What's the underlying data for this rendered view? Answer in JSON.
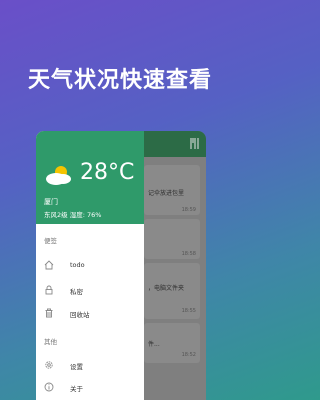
{
  "headline": "天气状况快速查看",
  "weather": {
    "temperature": "28°C",
    "city": "厦门",
    "details": "东风2级 湿度: 76%"
  },
  "drawer": {
    "section_notes": "便签",
    "items_notes": [
      {
        "label": "todo",
        "icon": "home-icon"
      },
      {
        "label": "私密",
        "icon": "lock-icon"
      },
      {
        "label": "回收站",
        "icon": "trash-icon"
      }
    ],
    "section_other": "其他",
    "items_other": [
      {
        "label": "设置",
        "icon": "gear-icon"
      },
      {
        "label": "关于",
        "icon": "info-icon"
      }
    ]
  },
  "background_list": [
    {
      "text": "记伞放进包里",
      "time": "18:59"
    },
    {
      "text": "",
      "time": "18:58"
    },
    {
      "text": "，电脑文件夹",
      "time": "18:55"
    },
    {
      "text": "件...",
      "time": "18:52"
    }
  ]
}
